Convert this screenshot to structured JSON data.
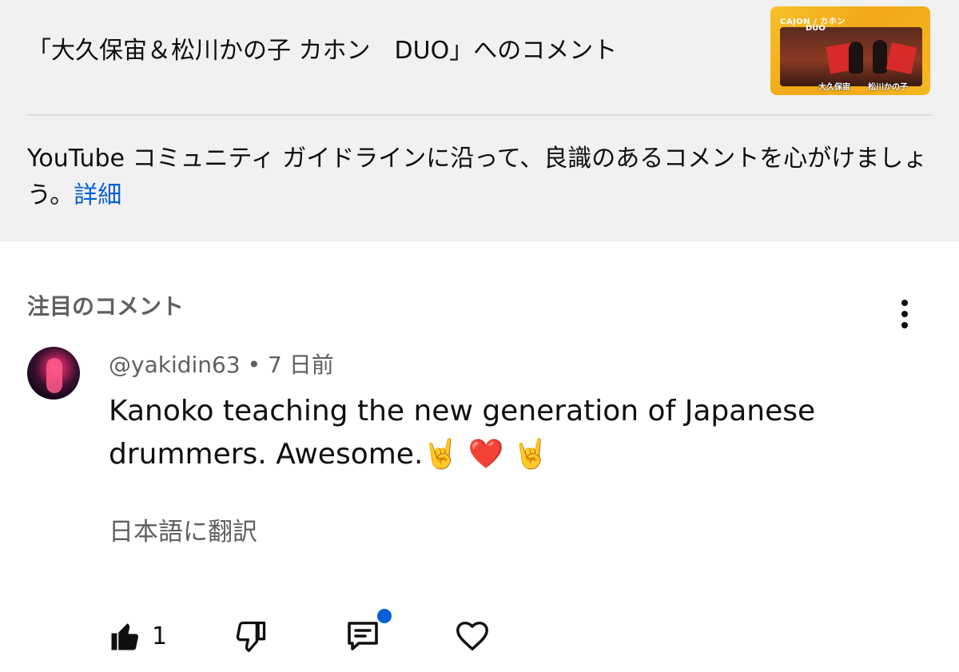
{
  "header": {
    "video_title": "「大久保宙＆松川かの子 カホン　DUO」へのコメント",
    "thumbnail": {
      "top_text": "CAJON / カホン",
      "duo_text": "DUO",
      "name_left": "大久保宙",
      "name_right": "松川かの子"
    }
  },
  "guidelines": {
    "text": "YouTube コミュニティ ガイドラインに沿って、良識のあるコメントを心がけましょう。",
    "link_label": "詳細"
  },
  "section": {
    "heading": "注目のコメント",
    "more_icon": "more-vertical-icon"
  },
  "comment": {
    "author": "@yakidin63",
    "separator": "•",
    "time": "7 日前",
    "text": "Kanoko teaching the new generation of Japanese drummers. Awesome.🤘 ❤️ 🤘",
    "translate_label": "日本語に翻訳"
  },
  "actions": {
    "like_icon": "thumbs-up-icon",
    "like_count": "1",
    "dislike_icon": "thumbs-down-icon",
    "reply_icon": "comment-icon",
    "reply_has_notification": true,
    "favorite_icon": "heart-icon"
  },
  "colors": {
    "panel_bg": "#f1f1f1",
    "link": "#065fd4",
    "secondary_text": "#606060",
    "notification_dot": "#065fd4"
  }
}
